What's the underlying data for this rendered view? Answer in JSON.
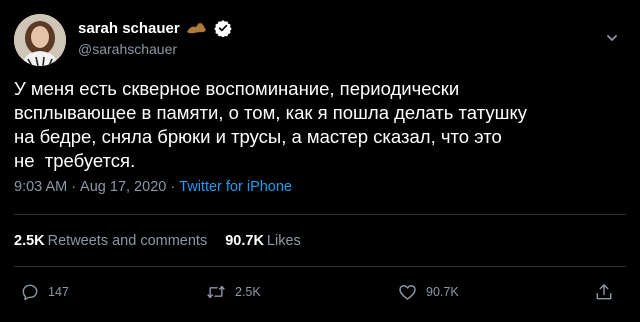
{
  "author": {
    "display_name": "sarah schauer",
    "handle": "@sarahschauer"
  },
  "tweet": {
    "text": "У меня есть скверное воспоминание, периодически\nвсплывающее в памяти, о том, как я пошла делать татушку\nна бедре, сняла брюки и трусы, а мастер сказал, что это\nне  требуется.",
    "time": "9:03 AM",
    "date": "Aug 17, 2020",
    "separator": "·",
    "source": "Twitter for iPhone"
  },
  "stats": {
    "retweets_count": "2.5K",
    "retweets_label": "Retweets and comments",
    "likes_count": "90.7K",
    "likes_label": "Likes"
  },
  "actions": {
    "reply_count": "147",
    "retweet_count": "2.5K",
    "like_count": "90.7K"
  },
  "colors": {
    "background": "#000000",
    "text": "#ffffff",
    "muted": "#8b98a5",
    "link": "#1d9bf0",
    "verified": "#ffffff",
    "divider": "#2f3336"
  },
  "icons": {
    "verified": "verified-badge-icon",
    "emoji": "flexed-arm-emoji-icon",
    "more": "chevron-down-icon",
    "reply": "reply-icon",
    "retweet": "retweet-icon",
    "like": "heart-icon",
    "share": "share-icon"
  }
}
